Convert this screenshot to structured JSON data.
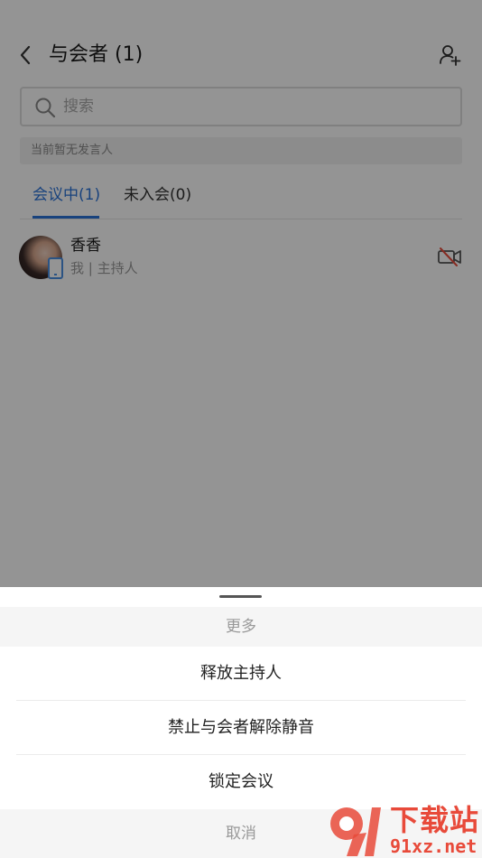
{
  "header": {
    "title": "与会者 (1)",
    "back_icon": "chevron-left-icon",
    "add_icon": "add-user-icon"
  },
  "search": {
    "placeholder": "搜索",
    "value": ""
  },
  "speaker_status": "当前暂无发言人",
  "tabs": [
    {
      "label": "会议中(1)",
      "active": true
    },
    {
      "label": "未入会(0)",
      "active": false
    }
  ],
  "participants": [
    {
      "name": "香香",
      "role": "我 | 主持人",
      "device_icon": "phone-icon",
      "video_icon": "video-off-icon"
    }
  ],
  "sheet": {
    "title": "更多",
    "items": [
      {
        "label": "释放主持人"
      },
      {
        "label": "禁止与会者解除静音"
      },
      {
        "label": "锁定会议"
      }
    ],
    "cancel_label": "取消"
  },
  "watermark": {
    "text_top": "下载站",
    "text_bottom": "91xz.net"
  },
  "colors": {
    "accent": "#2a73d8",
    "video_off": "#e84a3a",
    "watermark": "#e84a3a"
  }
}
